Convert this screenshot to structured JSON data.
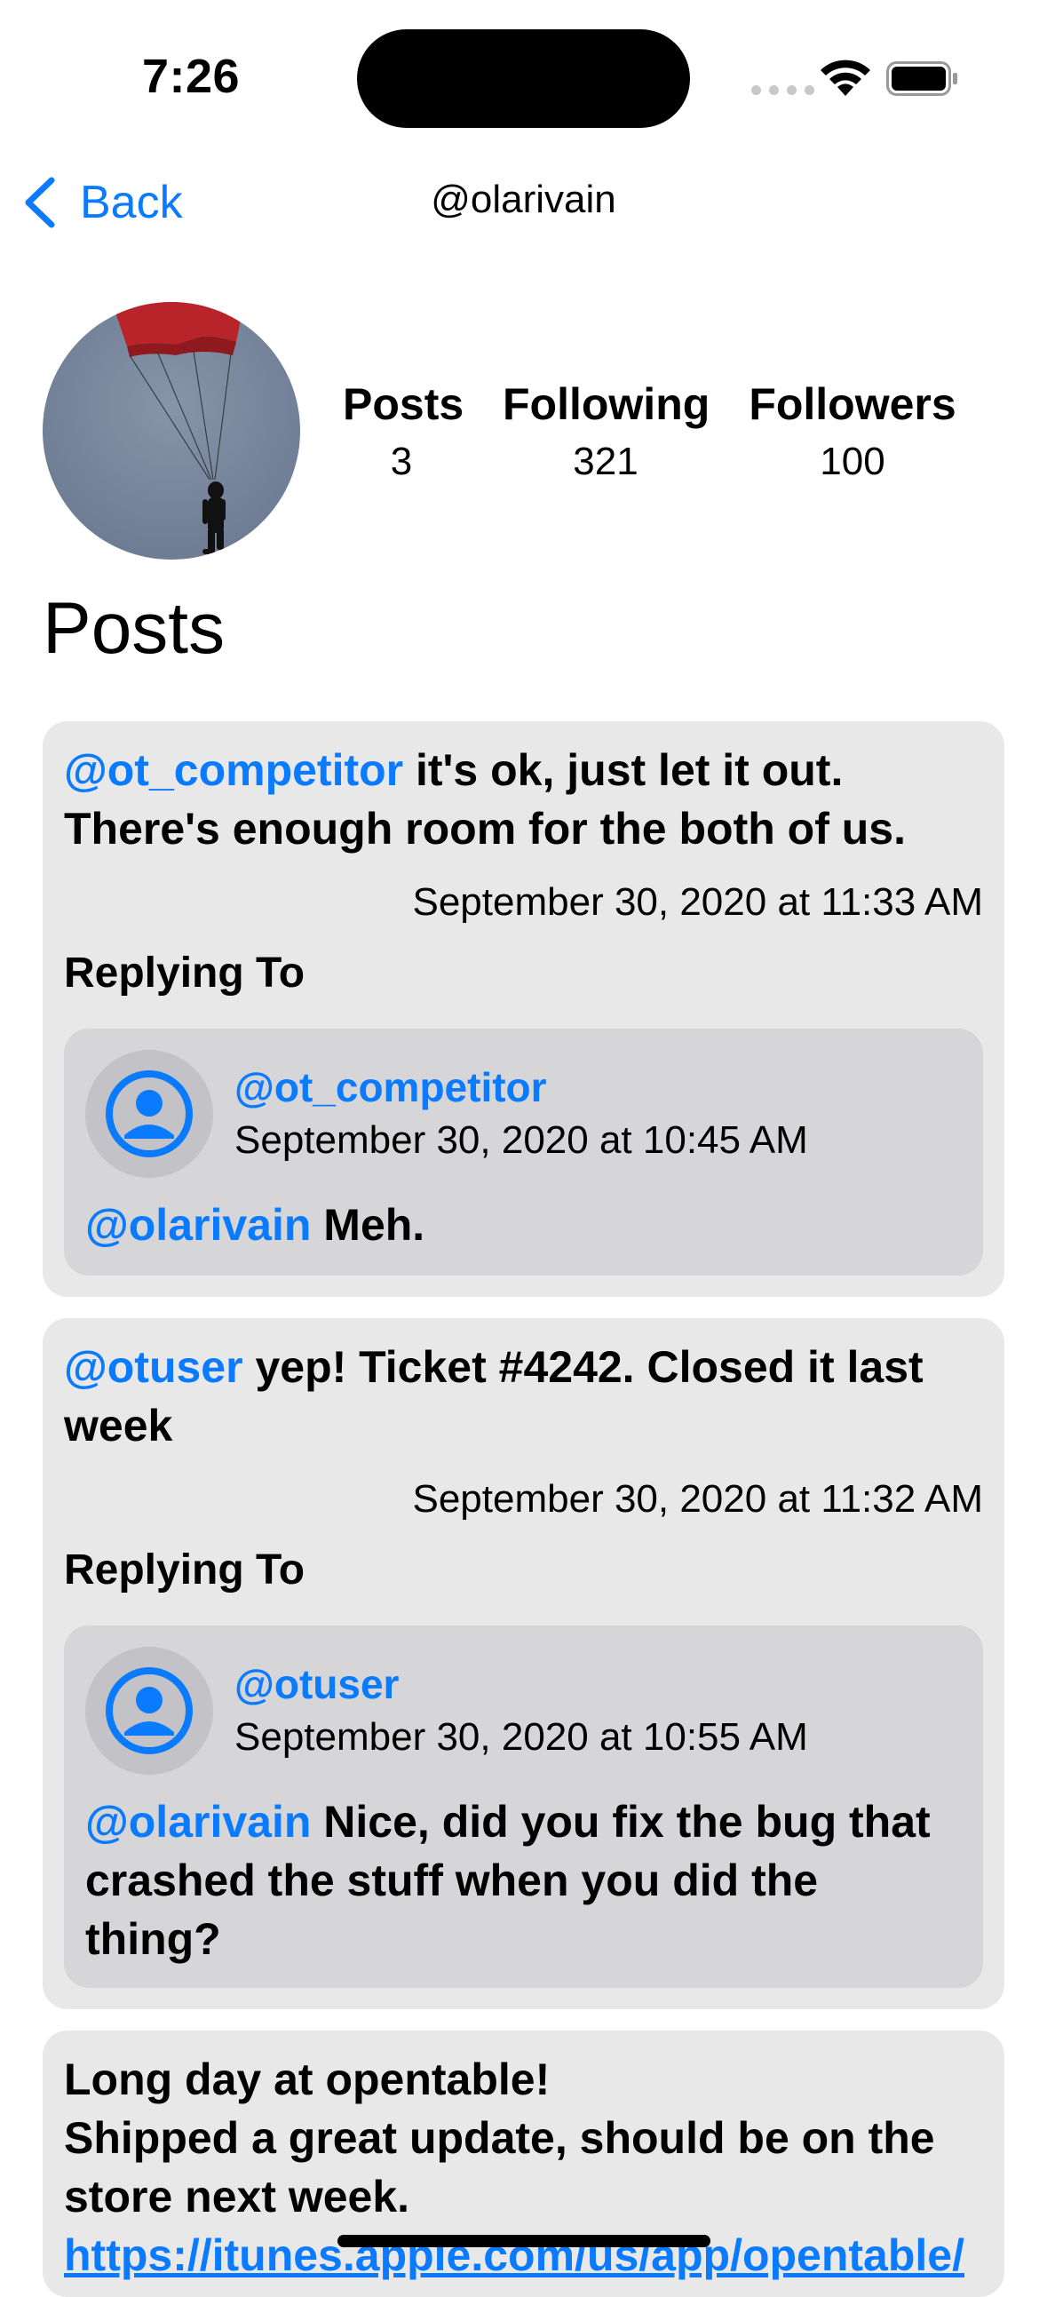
{
  "status_bar": {
    "time": "7:26"
  },
  "nav": {
    "back_label": "Back",
    "title": "@olarivain"
  },
  "profile": {
    "stats": [
      {
        "label": "Posts",
        "value": "3"
      },
      {
        "label": "Following",
        "value": "321"
      },
      {
        "label": "Followers",
        "value": "100"
      }
    ]
  },
  "section_title": "Posts",
  "posts": [
    {
      "mention": "@ot_competitor",
      "text": " it's ok, just let it out. There's enough room for the both of us.",
      "date": "September 30, 2020 at 11:33 AM",
      "replying_label": "Replying To",
      "reply": {
        "user": "@ot_competitor",
        "date": "September 30, 2020 at 10:45 AM",
        "mention": "@olarivain",
        "text": " Meh."
      }
    },
    {
      "mention": "@otuser",
      "text": " yep! Ticket #4242. Closed it last week",
      "date": "September 30, 2020 at 11:32 AM",
      "replying_label": "Replying To",
      "reply": {
        "user": "@otuser",
        "date": "September 30, 2020 at 10:55 AM",
        "mention": "@olarivain",
        "text": " Nice, did you fix the bug that crashed the stuff when you did the thing?"
      }
    },
    {
      "line1": "Long day at opentable!",
      "line2": "Shipped a great update, should be on the store next week.",
      "link": "https://itunes.apple.com/us/app/opentable/"
    }
  ]
}
